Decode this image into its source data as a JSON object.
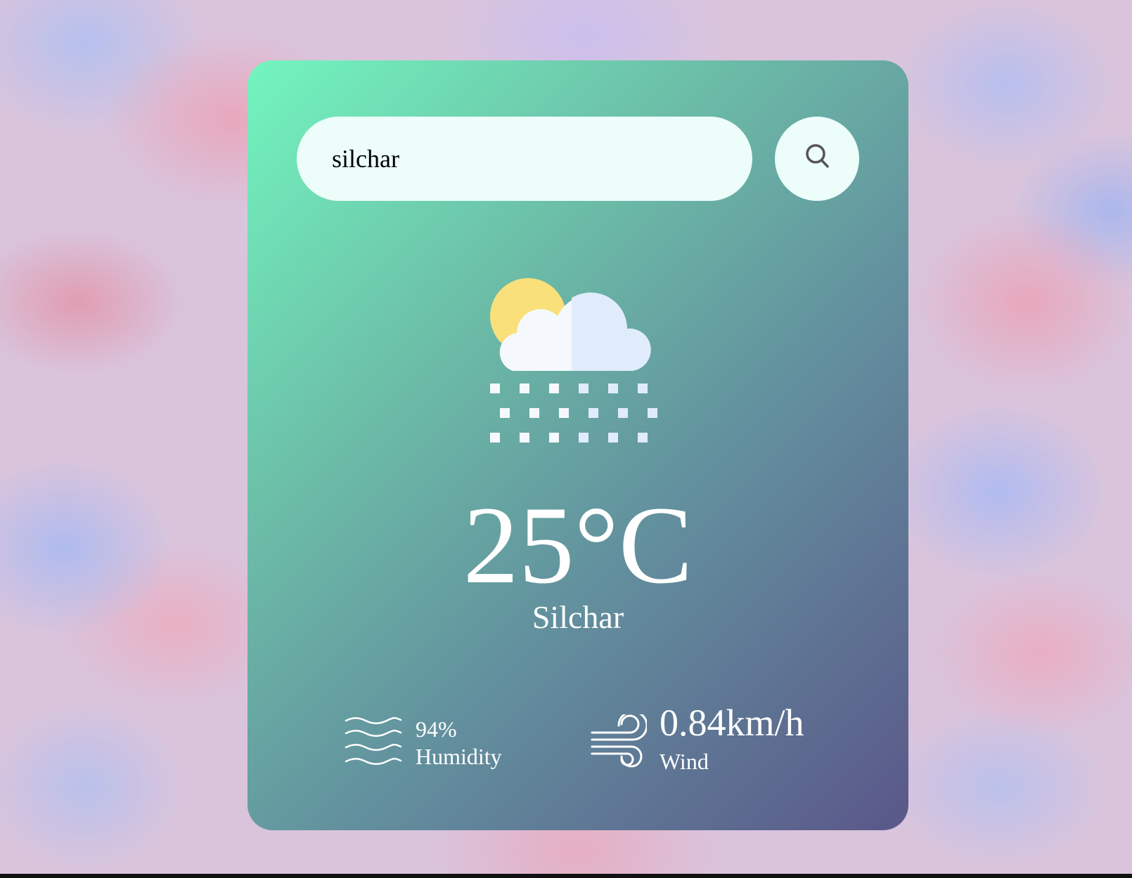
{
  "search": {
    "value": "silchar",
    "button_icon": "search-icon"
  },
  "weather": {
    "icon": "sun-cloud-snow-icon",
    "temperature": "25°C",
    "city": "Silchar"
  },
  "details": {
    "humidity": {
      "icon": "humidity-waves-icon",
      "value": "94%",
      "label": "Humidity"
    },
    "wind": {
      "icon": "wind-icon",
      "value": "0.84km/h",
      "label": "Wind"
    }
  },
  "colors": {
    "card_gradient_start": "#72f5be",
    "card_gradient_end": "#5a5789",
    "search_background": "#ecfdfa",
    "text": "#ffffff",
    "sun": "#f9e07a",
    "cloud_light": "#f5f9fd",
    "cloud_shade": "#e0ecfb"
  }
}
